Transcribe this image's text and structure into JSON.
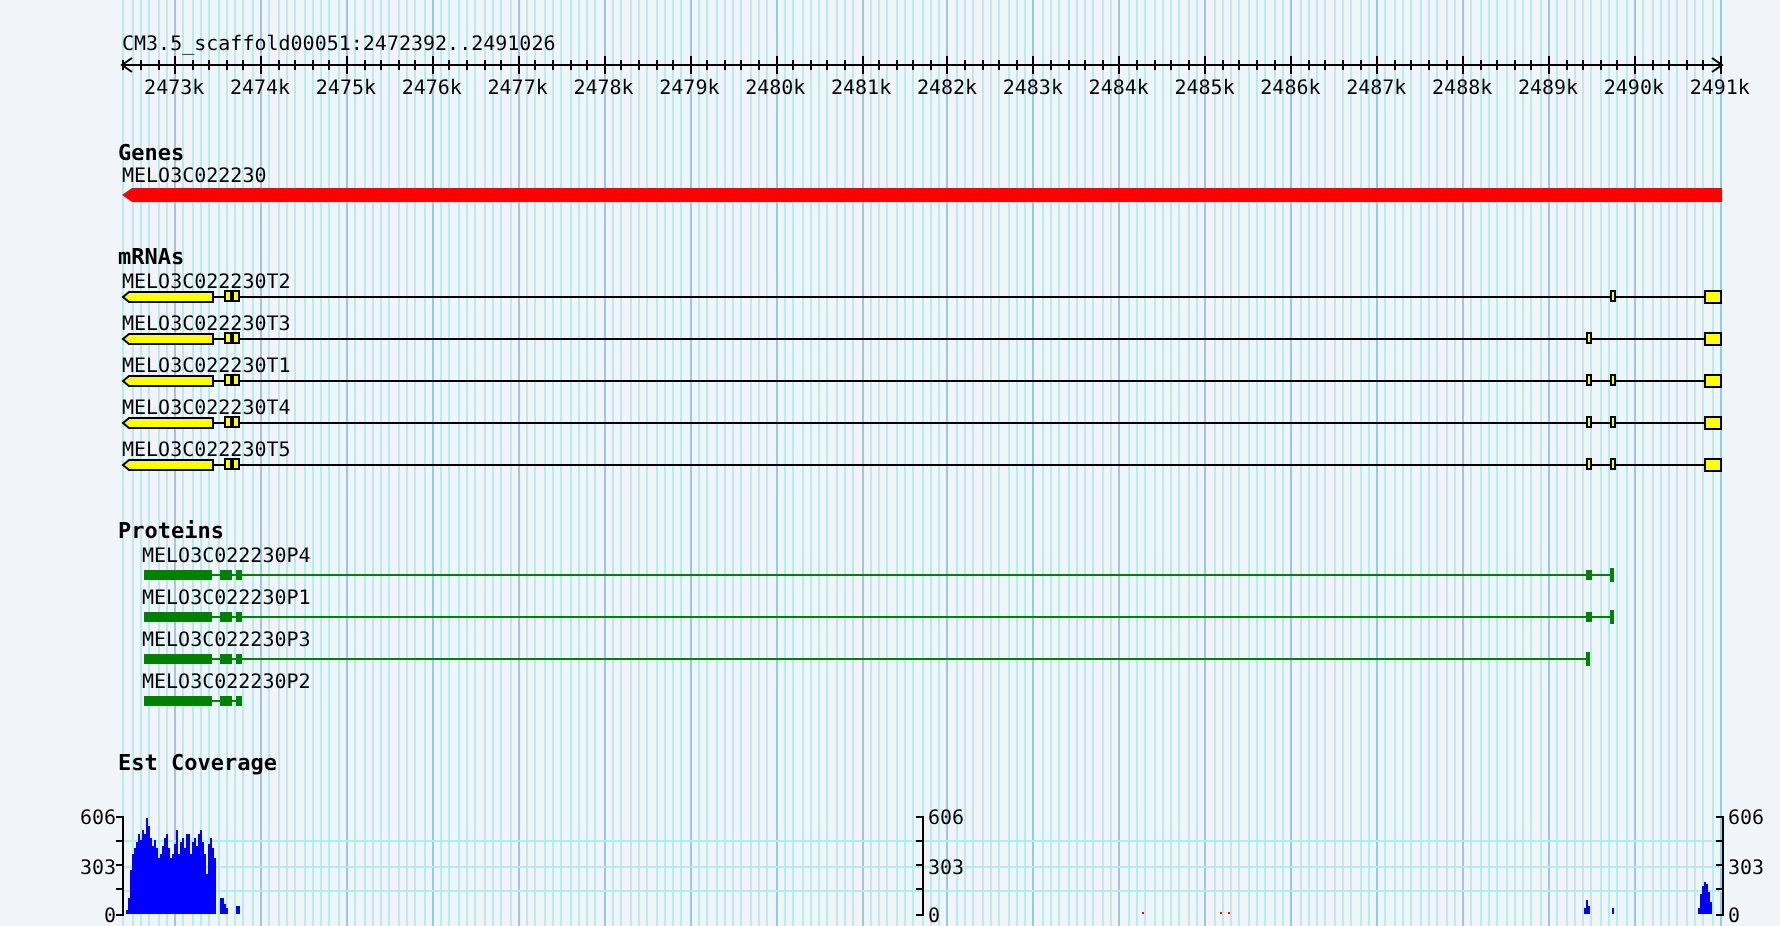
{
  "location": "CM3.5_scaffold00051:2472392..2491026",
  "ruler": {
    "ticks": [
      "2473k",
      "2474k",
      "2475k",
      "2476k",
      "2477k",
      "2478k",
      "2479k",
      "2480k",
      "2481k",
      "2482k",
      "2483k",
      "2484k",
      "2485k",
      "2486k",
      "2487k",
      "2488k",
      "2489k",
      "2490k",
      "2491k"
    ]
  },
  "tracks": [
    {
      "kind": "gene",
      "title": "Genes",
      "features": [
        {
          "name": "MELO3C022230"
        }
      ]
    },
    {
      "kind": "mrna",
      "title": "mRNAs",
      "features": [
        {
          "name": "MELO3C022230T2"
        },
        {
          "name": "MELO3C022230T3"
        },
        {
          "name": "MELO3C022230T1"
        },
        {
          "name": "MELO3C022230T4"
        },
        {
          "name": "MELO3C022230T5"
        }
      ]
    },
    {
      "kind": "protein",
      "title": "Proteins",
      "features": [
        {
          "name": "MELO3C022230P4"
        },
        {
          "name": "MELO3C022230P1"
        },
        {
          "name": "MELO3C022230P3"
        },
        {
          "name": "MELO3C022230P2"
        }
      ]
    },
    {
      "kind": "coverage",
      "title": "Est Coverage",
      "axes": [
        {
          "labels": [
            "606",
            "303",
            "0"
          ]
        },
        {
          "labels": [
            "606",
            "303",
            "0"
          ]
        },
        {
          "labels": [
            "606",
            "303",
            "0"
          ]
        }
      ]
    }
  ]
}
